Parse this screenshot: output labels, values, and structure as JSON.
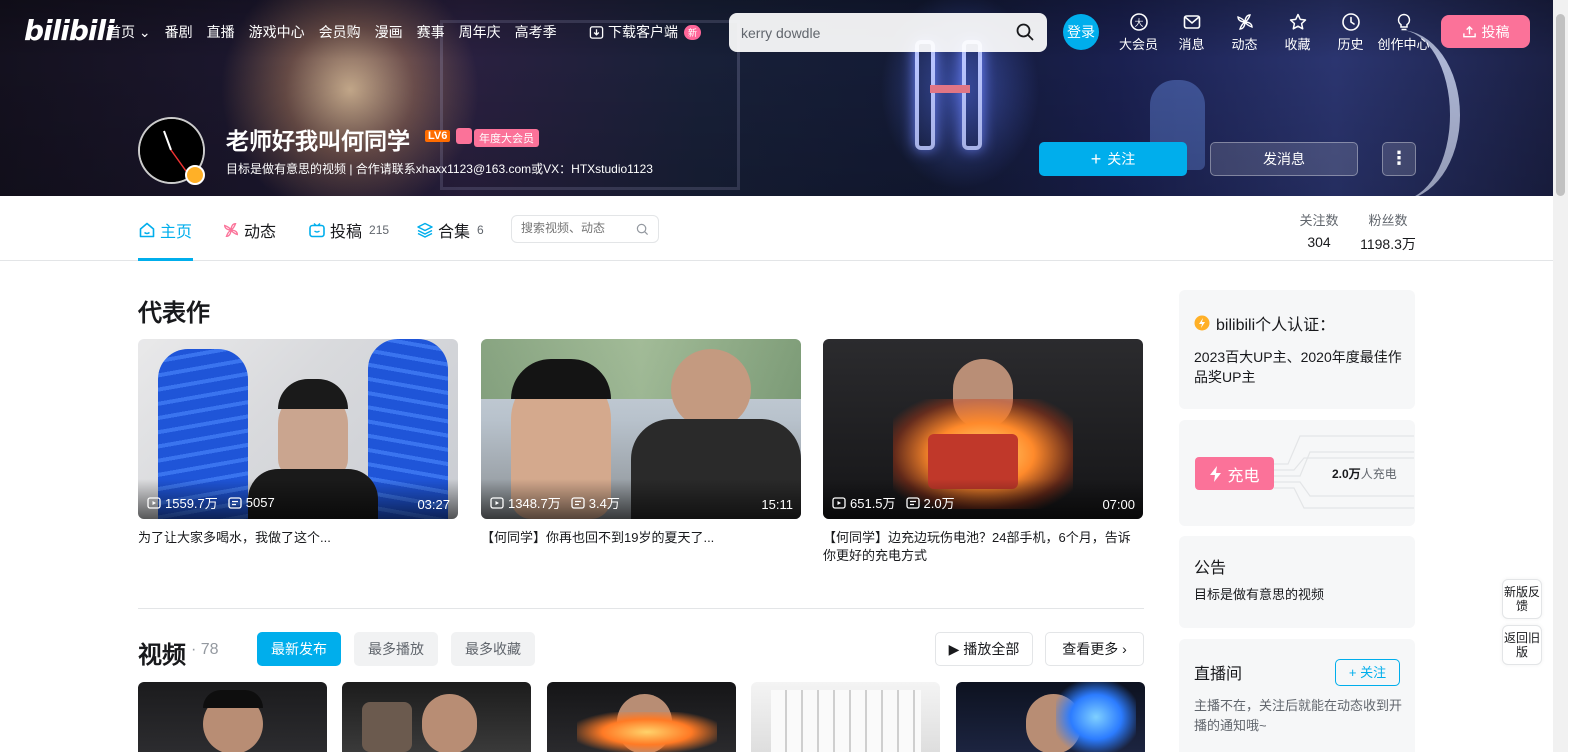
{
  "nav": {
    "logo": "bilibili",
    "links": [
      "首页",
      "番剧",
      "直播",
      "游戏中心",
      "会员购",
      "漫画",
      "赛事",
      "周年庆",
      "高考季"
    ],
    "download": "下载客户端",
    "new_badge": "新",
    "search_value": "kerry dowdle",
    "login": "登录",
    "right": [
      "大会员",
      "消息",
      "动态",
      "收藏",
      "历史",
      "创作中心"
    ],
    "upload": "投稿"
  },
  "profile": {
    "name": "老师好我叫何同学",
    "level": "LV6",
    "vip": "年度大会员",
    "sign": "目标是做有意思的视频 | 合作请联系xhaxx1123@163.com或VX：HTXstudio1123",
    "follow_btn": "关注",
    "message_btn": "发消息",
    "more_btn": "⋮"
  },
  "tabs": [
    {
      "label": "主页",
      "count": ""
    },
    {
      "label": "动态",
      "count": ""
    },
    {
      "label": "投稿",
      "count": "215"
    },
    {
      "label": "合集",
      "count": "6"
    }
  ],
  "tab_search_placeholder": "搜索视频、动态",
  "stats": {
    "following_label": "关注数",
    "following": "304",
    "fans_label": "粉丝数",
    "fans": "1198.3万"
  },
  "masterpiece": {
    "title": "代表作",
    "cards": [
      {
        "plays": "1559.7万",
        "danmaku": "5057",
        "duration": "03:27",
        "title": "为了让大家多喝水，我做了这个..."
      },
      {
        "plays": "1348.7万",
        "danmaku": "3.4万",
        "duration": "15:11",
        "title": "【何同学】你再也回不到19岁的夏天了..."
      },
      {
        "plays": "651.5万",
        "danmaku": "2.0万",
        "duration": "07:00",
        "title": "【何同学】边充边玩伤电池？24部手机，6个月，告诉你更好的充电方式"
      }
    ]
  },
  "videos": {
    "title": "视频",
    "count": "· 78",
    "filters": [
      "最新发布",
      "最多播放",
      "最多收藏"
    ],
    "play_all": "播放全部",
    "see_more": "查看更多"
  },
  "sidebar": {
    "cert_title": "bilibili个人认证：",
    "cert_body": "2023百大UP主、2020年度最佳作品奖UP主",
    "charge_btn": "充电",
    "charge_count": "2.0万",
    "charge_suffix": "人充电",
    "notice_title": "公告",
    "notice_body": "目标是做有意思的视频",
    "live_title": "直播间",
    "live_follow": "关注",
    "live_body": "主播不在，关注后就能在动态收到开播的通知哦~"
  },
  "float": {
    "new_feedback": "新版反馈",
    "back_old": "返回旧版"
  },
  "colors": {
    "brand_blue": "#00aeec",
    "brand_pink": "#fb7299"
  }
}
